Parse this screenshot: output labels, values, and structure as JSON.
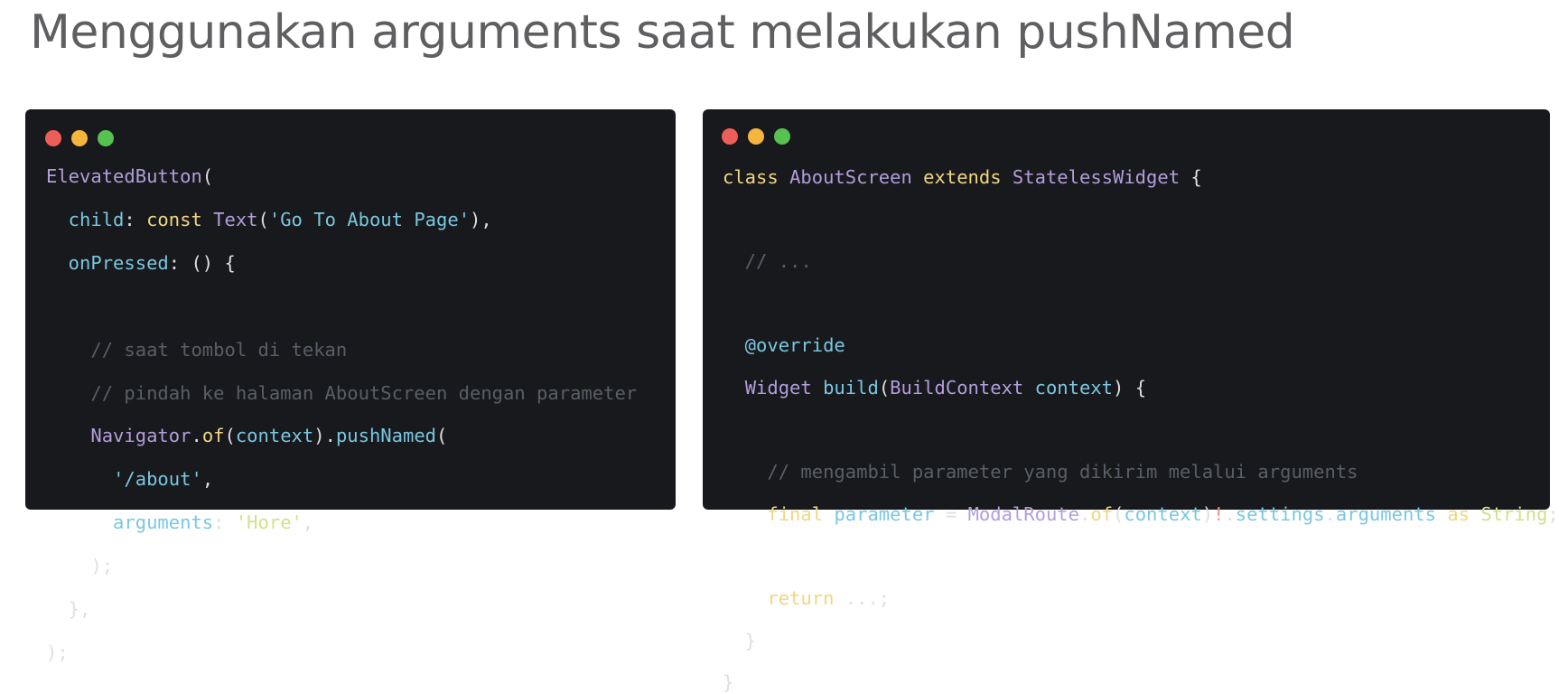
{
  "title": "Menggunakan arguments saat melakukan pushNamed",
  "colors": {
    "background": "#ffffff",
    "title": "#5f5f62",
    "window": "#18191c",
    "dot_red": "#ee5e58",
    "dot_yellow": "#f5b53f",
    "dot_green": "#56c24f"
  },
  "left_code": {
    "l1": [
      "ElevatedButton",
      "("
    ],
    "l2": [
      "  child",
      ": ",
      "const",
      " ",
      "Text",
      "(",
      "'Go To About Page'",
      "),"
    ],
    "l3": [
      "  onPressed",
      ": () {"
    ],
    "l5": "    // saat tombol di tekan",
    "l6": "    // pindah ke halaman AboutScreen dengan parameter",
    "l7": [
      "    ",
      "Navigator",
      ".",
      "of",
      "(",
      "context",
      ").",
      "pushNamed",
      "("
    ],
    "l8": [
      "      ",
      "'/about'",
      ","
    ],
    "l9": [
      "      arguments",
      ": ",
      "'Hore'",
      ","
    ],
    "l10": "    );",
    "l11": "  },",
    "l12": ");"
  },
  "right_code": {
    "l1": [
      "class",
      " ",
      "AboutScreen",
      " ",
      "extends",
      " ",
      "StatelessWidget",
      " {"
    ],
    "l3": "  // ...",
    "l5": "  @override",
    "l6": [
      "  ",
      "Widget",
      " ",
      "build",
      "(",
      "BuildContext",
      " ",
      "context",
      ") {"
    ],
    "l8": "    // mengambil parameter yang dikirim melalui arguments",
    "l9": [
      "    ",
      "final",
      " ",
      "parameter",
      " = ",
      "ModalRoute",
      ".",
      "of",
      "(",
      "context",
      ")",
      "!",
      ".",
      "settings",
      ".",
      "arguments",
      " ",
      "as",
      " ",
      "String",
      ";"
    ],
    "l11": [
      "    ",
      "return",
      " ...;"
    ],
    "l12": "  }",
    "l13": "}"
  }
}
